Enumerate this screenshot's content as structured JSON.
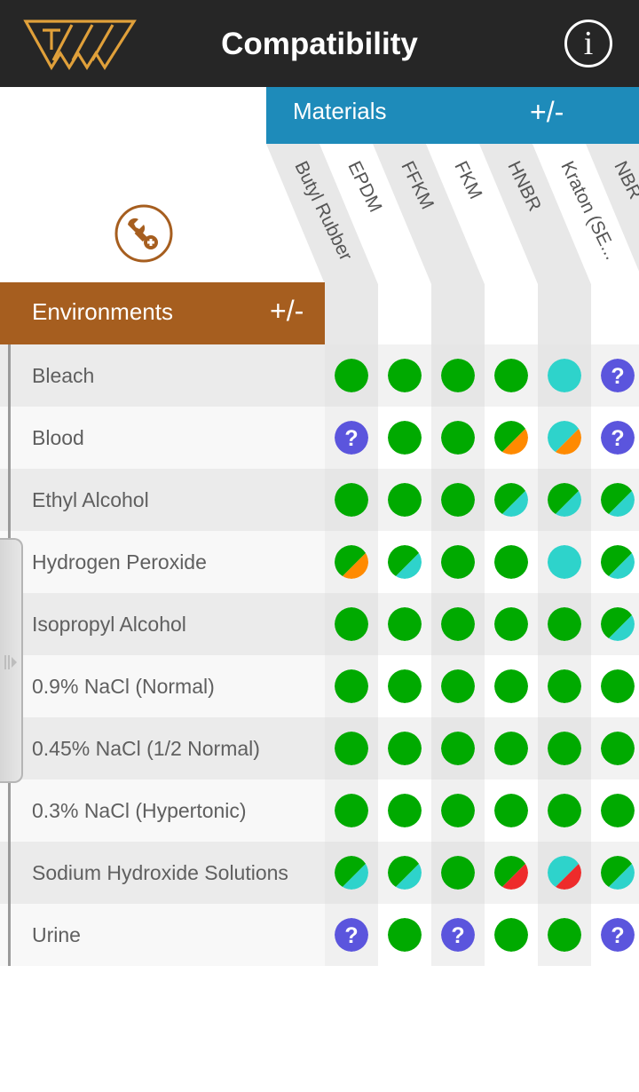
{
  "header": {
    "title": "Compatibility",
    "logo_icon": "tww-logo-icon",
    "info_icon": "info-icon",
    "info_glyph": "i",
    "logo_color": "#E0A03A"
  },
  "materials": {
    "label": "Materials",
    "toggle_label": "+/-",
    "color": "#1E8BBA",
    "columns": [
      "Butyl Rubber",
      "EPDM",
      "FFKM",
      "FKM",
      "HNBR",
      "Kraton (SE...",
      "NBR"
    ]
  },
  "tool_icon": "wrench-settings-icon",
  "environments": {
    "label": "Environments",
    "toggle_label": "+/-",
    "color": "#A65E1F"
  },
  "legend_colors": {
    "compatible": "#00AA00",
    "limited": "#2ED3CB",
    "moderate": "#FF8A00",
    "not_compatible": "#EE2B2B",
    "unknown": "#5B55DD"
  },
  "rows": [
    {
      "environment": "Bleach",
      "ratings": [
        "green",
        "green",
        "green",
        "green",
        "cyan",
        "unknown"
      ]
    },
    {
      "environment": "Blood",
      "ratings": [
        "unknown",
        "green",
        "green",
        "green/orange",
        "cyan/orange",
        "unknown"
      ]
    },
    {
      "environment": "Ethyl Alcohol",
      "ratings": [
        "green",
        "green",
        "green",
        "green/cyan",
        "green/cyan",
        "green/cyan"
      ]
    },
    {
      "environment": "Hydrogen Peroxide",
      "ratings": [
        "green/orange",
        "green/cyan",
        "green",
        "green",
        "cyan",
        "green/cyan"
      ]
    },
    {
      "environment": "Isopropyl Alcohol",
      "ratings": [
        "green",
        "green",
        "green",
        "green",
        "green",
        "green/cyan"
      ]
    },
    {
      "environment": "0.9% NaCl (Normal)",
      "ratings": [
        "green",
        "green",
        "green",
        "green",
        "green",
        "green"
      ]
    },
    {
      "environment": "0.45% NaCl (1/2 Normal)",
      "ratings": [
        "green",
        "green",
        "green",
        "green",
        "green",
        "green"
      ]
    },
    {
      "environment": "0.3% NaCl (Hypertonic)",
      "ratings": [
        "green",
        "green",
        "green",
        "green",
        "green",
        "green"
      ]
    },
    {
      "environment": "Sodium Hydroxide Solutions",
      "ratings": [
        "green/cyan",
        "green/cyan",
        "green",
        "green/red",
        "cyan/red",
        "green/cyan"
      ]
    },
    {
      "environment": "Urine",
      "ratings": [
        "unknown",
        "green",
        "unknown",
        "green",
        "green",
        "unknown"
      ]
    }
  ],
  "unknown_glyph": "?",
  "drawer_handle_icon": "drawer-grip-icon"
}
